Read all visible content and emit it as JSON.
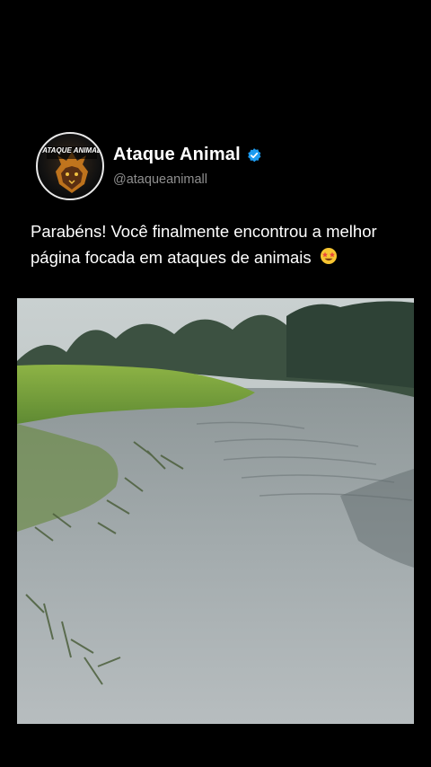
{
  "profile": {
    "display_name": "Ataque Animal",
    "handle": "@ataqueanimall",
    "avatar_label": "ATAQUE ANIMAL",
    "verified": true
  },
  "post": {
    "caption": "Parabéns! Você finalmente encontrou a melhor página focada em ataques de animais",
    "caption_emoji": "star-struck-emoji"
  },
  "media": {
    "type": "video-frame",
    "description_icon": "river-scene"
  },
  "colors": {
    "background": "#000000",
    "verified_blue": "#1d9bf0",
    "handle_gray": "#8f8f8f",
    "text": "#ffffff"
  }
}
